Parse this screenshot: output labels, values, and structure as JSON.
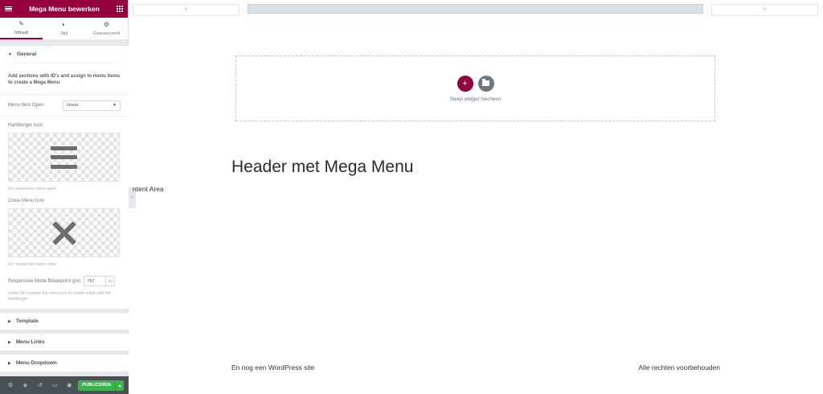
{
  "sidebar": {
    "header_title": "Mega Menu bewerken",
    "tabs": [
      {
        "label": "Inhoud",
        "icon": "pencil-icon"
      },
      {
        "label": "Stijl",
        "icon": "contrast-icon"
      },
      {
        "label": "Geavanceerd",
        "icon": "gear-icon"
      }
    ],
    "sections": {
      "general_title": "General",
      "general_description": "Add sections with ID's and assign to menu items to create a Mega Menu",
      "menu_item_open_label": "Menu Item Open",
      "menu_item_open_value": "Hover",
      "hamburger_icon_label": "Hamburger Icon",
      "hamburger_hint": "For responsive menu open",
      "close_icon_label": "Close Menu Icon",
      "close_hint": "For responsive menu close",
      "breakpoint_label": "Responsive Mode Breakpoint (px)",
      "breakpoint_value": "767",
      "breakpoint_hint": "Under this number the menu turn to mobile mode with the hamburger",
      "template_title": "Template",
      "menu_links_title": "Menu Links",
      "menu_dropdown_title": "Menu Dropdown"
    },
    "footer": {
      "icons": [
        "gear-icon",
        "layers-icon",
        "history-icon",
        "responsive-icon",
        "eye-icon"
      ],
      "publish_label": "PUBLICEREN"
    }
  },
  "canvas": {
    "dropzone_text": "Sleep widget hierheen",
    "heading": "Header met Mega Menu",
    "content_area": "ntent Area",
    "footer_left": "En nog een WordPress site",
    "footer_right": "Alle rechten voorbehouden",
    "top_plus": "+"
  },
  "colors": {
    "brand": "#93003c",
    "publish": "#39b54a",
    "sidebar_bg": "#e6e9ec",
    "footer_bg": "#495157"
  }
}
